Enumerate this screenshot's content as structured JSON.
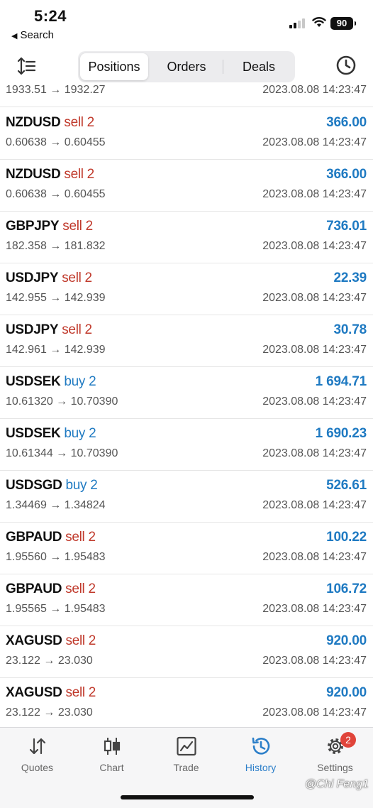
{
  "status_bar": {
    "time": "5:24",
    "back_label": "Search",
    "battery": "90"
  },
  "header": {
    "tabs": [
      {
        "label": "Positions",
        "active": true
      },
      {
        "label": "Orders",
        "active": false
      },
      {
        "label": "Deals",
        "active": false
      }
    ]
  },
  "deals": [
    {
      "symbol": "",
      "side": "",
      "volume": "",
      "prices": "1933.51 → 1932.27",
      "profit": "",
      "date": "2023.08.08 14:23:47"
    },
    {
      "symbol": "NZDUSD",
      "side": "sell",
      "volume": "2",
      "prices": "0.60638 → 0.60455",
      "profit": "366.00",
      "date": "2023.08.08 14:23:47"
    },
    {
      "symbol": "NZDUSD",
      "side": "sell",
      "volume": "2",
      "prices": "0.60638 → 0.60455",
      "profit": "366.00",
      "date": "2023.08.08 14:23:47"
    },
    {
      "symbol": "GBPJPY",
      "side": "sell",
      "volume": "2",
      "prices": "182.358 → 181.832",
      "profit": "736.01",
      "date": "2023.08.08 14:23:47"
    },
    {
      "symbol": "USDJPY",
      "side": "sell",
      "volume": "2",
      "prices": "142.955 → 142.939",
      "profit": "22.39",
      "date": "2023.08.08 14:23:47"
    },
    {
      "symbol": "USDJPY",
      "side": "sell",
      "volume": "2",
      "prices": "142.961 → 142.939",
      "profit": "30.78",
      "date": "2023.08.08 14:23:47"
    },
    {
      "symbol": "USDSEK",
      "side": "buy",
      "volume": "2",
      "prices": "10.61320 → 10.70390",
      "profit": "1 694.71",
      "date": "2023.08.08 14:23:47"
    },
    {
      "symbol": "USDSEK",
      "side": "buy",
      "volume": "2",
      "prices": "10.61344 → 10.70390",
      "profit": "1 690.23",
      "date": "2023.08.08 14:23:47"
    },
    {
      "symbol": "USDSGD",
      "side": "buy",
      "volume": "2",
      "prices": "1.34469 → 1.34824",
      "profit": "526.61",
      "date": "2023.08.08 14:23:47"
    },
    {
      "symbol": "GBPAUD",
      "side": "sell",
      "volume": "2",
      "prices": "1.95560 → 1.95483",
      "profit": "100.22",
      "date": "2023.08.08 14:23:47"
    },
    {
      "symbol": "GBPAUD",
      "side": "sell",
      "volume": "2",
      "prices": "1.95565 → 1.95483",
      "profit": "106.72",
      "date": "2023.08.08 14:23:47"
    },
    {
      "symbol": "XAGUSD",
      "side": "sell",
      "volume": "2",
      "prices": "23.122 → 23.030",
      "profit": "920.00",
      "date": "2023.08.08 14:23:47"
    },
    {
      "symbol": "XAGUSD",
      "side": "sell",
      "volume": "2",
      "prices": "23.122 → 23.030",
      "profit": "920.00",
      "date": "2023.08.08 14:23:47"
    }
  ],
  "tabbar": {
    "items": [
      {
        "label": "Quotes",
        "icon": "quotes-icon"
      },
      {
        "label": "Chart",
        "icon": "chart-icon"
      },
      {
        "label": "Trade",
        "icon": "trade-icon"
      },
      {
        "label": "History",
        "icon": "history-icon",
        "active": true
      },
      {
        "label": "Settings",
        "icon": "settings-icon",
        "badge": "2"
      }
    ]
  },
  "watermark": "@Chi Feng1",
  "colors": {
    "sell": "#c0392b",
    "buy": "#1f7ac2",
    "profit": "#1f7ac2",
    "active_tab": "#2c7fc9",
    "badge": "#e0443a"
  }
}
